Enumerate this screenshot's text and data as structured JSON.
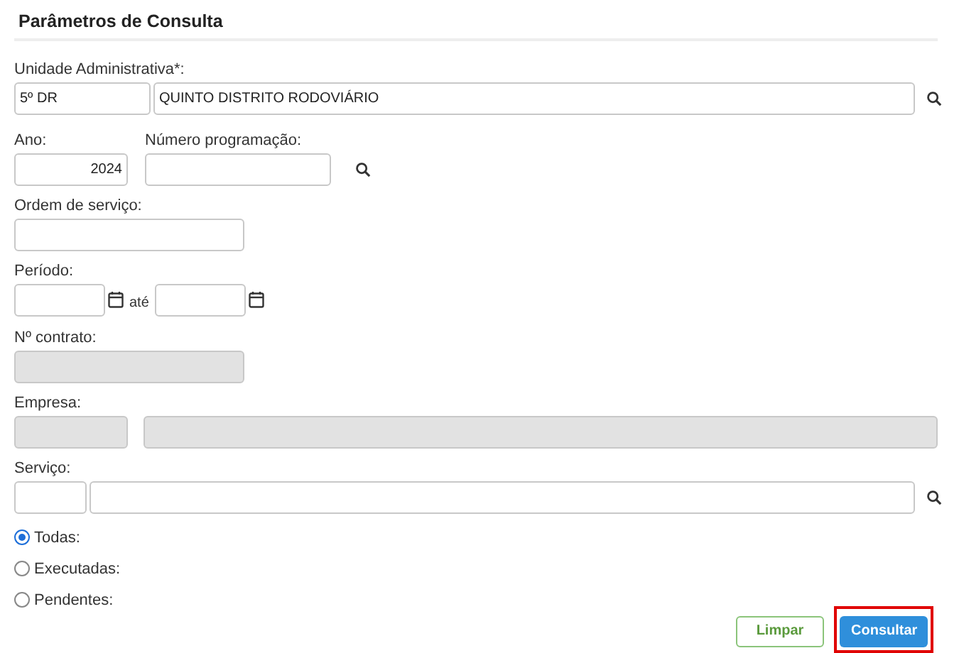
{
  "section_title": "Parâmetros de Consulta",
  "unidade": {
    "label": "Unidade Administrativa*:",
    "code": "5º DR",
    "name": "QUINTO DISTRITO RODOVIÁRIO"
  },
  "ano": {
    "label": "Ano:",
    "value": "2024"
  },
  "numero_programacao": {
    "label": "Número programação:"
  },
  "ordem_servico": {
    "label": "Ordem de serviço:"
  },
  "periodo": {
    "label": "Período:",
    "separator": "até"
  },
  "contrato": {
    "label": "Nº contrato:",
    "disabled": true
  },
  "empresa": {
    "label": "Empresa:",
    "disabled": true
  },
  "servico": {
    "label": "Serviço:"
  },
  "radios": [
    {
      "label": "Todas:",
      "selected": true
    },
    {
      "label": "Executadas:",
      "selected": false
    },
    {
      "label": "Pendentes:",
      "selected": false
    }
  ],
  "buttons": [
    {
      "label": "Limpar",
      "kind": "secondary",
      "highlighted": false
    },
    {
      "label": "Consultar",
      "kind": "primary",
      "highlighted": true
    }
  ]
}
